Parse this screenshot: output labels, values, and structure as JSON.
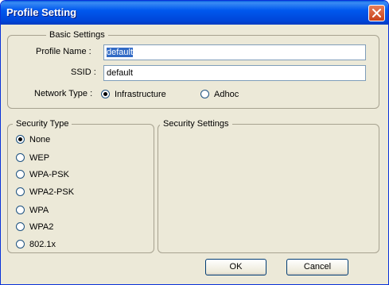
{
  "window": {
    "title": "Profile Setting"
  },
  "basic_settings": {
    "legend": "Basic Settings",
    "profile_name_label": "Profile Name :",
    "profile_name_value": "default",
    "ssid_label": "SSID :",
    "ssid_value": "default",
    "network_type_label": "Network Type :",
    "network_type_options": [
      "Infrastructure",
      "Adhoc"
    ],
    "network_type_selected": "Infrastructure"
  },
  "security_type": {
    "legend": "Security Type",
    "options": [
      "None",
      "WEP",
      "WPA-PSK",
      "WPA2-PSK",
      "WPA",
      "WPA2",
      "802.1x"
    ],
    "selected": "None"
  },
  "security_settings": {
    "legend": "Security Settings"
  },
  "buttons": {
    "ok": "OK",
    "cancel": "Cancel"
  },
  "colors": {
    "title_bar": "#0054e3",
    "dialog_bg": "#ece9d8",
    "close_button": "#d65a31",
    "selection": "#316ac5"
  }
}
